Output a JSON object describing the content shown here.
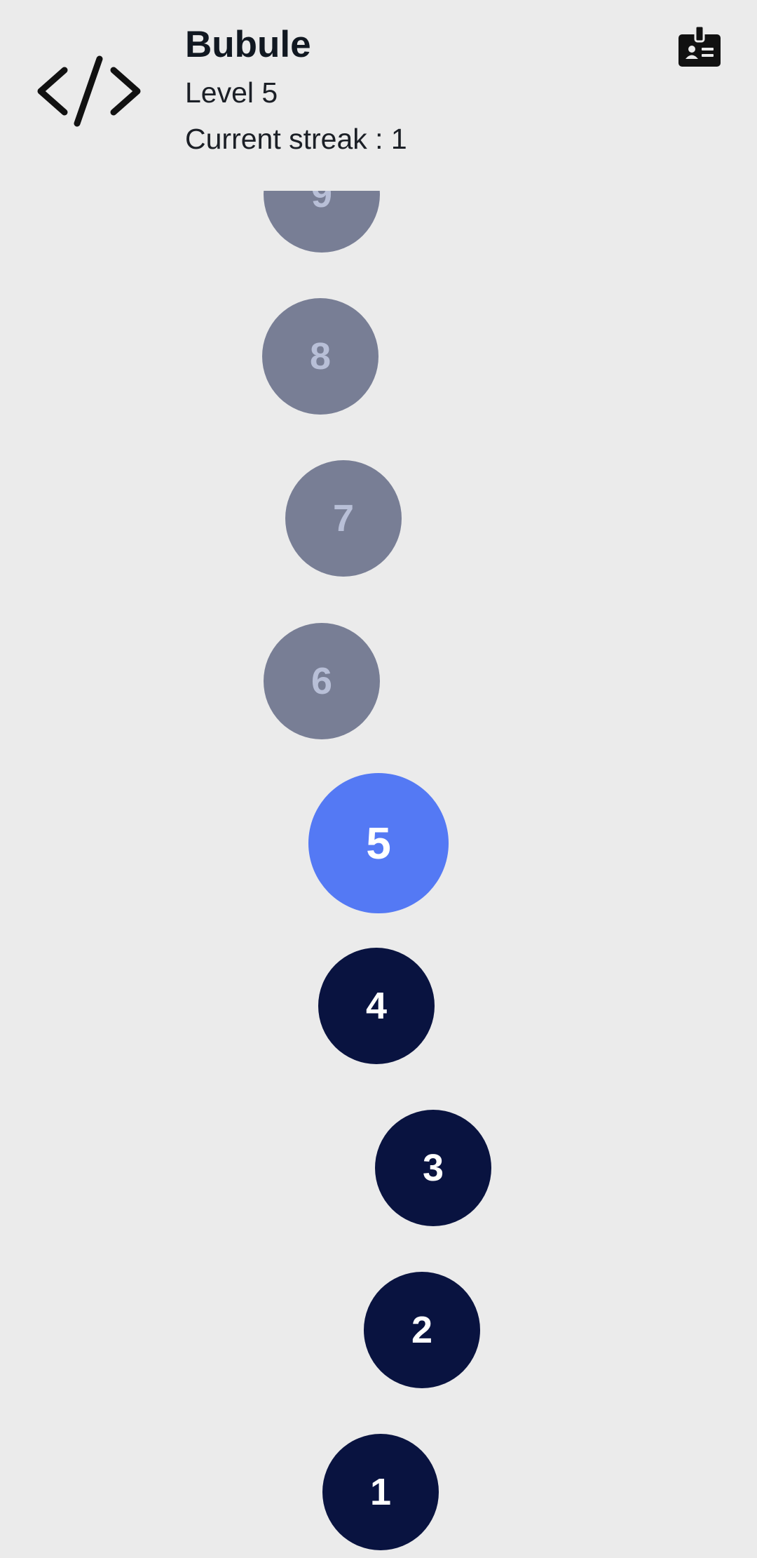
{
  "header": {
    "title": "Bubule",
    "level": "Level 5",
    "streak": "Current streak : 1",
    "left_icon": "code-icon",
    "right_icon": "id-badge-icon"
  },
  "colors": {
    "background": "#ebebeb",
    "locked": "#787e95",
    "locked_text": "#b8bfd7",
    "current": "#5479f4",
    "completed": "#091340"
  },
  "levels": [
    {
      "label": "9",
      "state": "locked"
    },
    {
      "label": "8",
      "state": "locked"
    },
    {
      "label": "7",
      "state": "locked"
    },
    {
      "label": "6",
      "state": "locked"
    },
    {
      "label": "5",
      "state": "current"
    },
    {
      "label": "4",
      "state": "completed"
    },
    {
      "label": "3",
      "state": "completed"
    },
    {
      "label": "2",
      "state": "completed"
    },
    {
      "label": "1",
      "state": "completed"
    }
  ]
}
